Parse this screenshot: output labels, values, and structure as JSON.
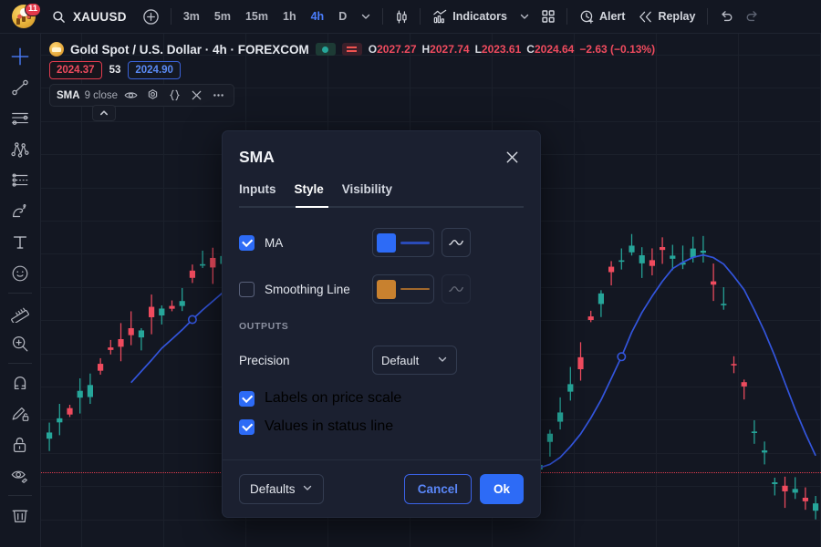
{
  "topbar": {
    "logo_badge": "11",
    "search_icon": "search-icon",
    "symbol": "XAUUSD",
    "plus_icon": "plus-circle-icon",
    "timeframes": [
      {
        "label": "3m",
        "active": false
      },
      {
        "label": "5m",
        "active": false
      },
      {
        "label": "15m",
        "active": false
      },
      {
        "label": "1h",
        "active": false
      },
      {
        "label": "4h",
        "active": true
      },
      {
        "label": "D",
        "active": false
      }
    ],
    "timeframe_caret": "chevron-down-icon",
    "candle_icon": "candlestick-icon",
    "indicators_label": "Indicators",
    "indicators_caret": "chevron-down-icon",
    "templates_icon": "grid-templates-icon",
    "alert_label": "Alert",
    "replay_label": "Replay",
    "undo_icon": "undo-icon",
    "redo_icon": "redo-icon"
  },
  "leftbar": {
    "tools": [
      {
        "name": "crosshair-tool",
        "active": true
      },
      {
        "name": "trend-line-tool",
        "active": false
      },
      {
        "name": "horizontal-lines-tool",
        "active": false
      },
      {
        "name": "pitchfork-tool",
        "active": false
      },
      {
        "name": "fib-retracement-tool",
        "active": false
      },
      {
        "name": "brush-tool",
        "active": false
      },
      {
        "name": "text-tool",
        "active": false
      },
      {
        "name": "emoji-tool",
        "active": false
      },
      {
        "name": "measure-tool",
        "active": false
      },
      {
        "name": "zoom-in-tool",
        "active": false
      },
      {
        "name": "magnet-tool",
        "active": false
      },
      {
        "name": "drawing-mode-tool",
        "active": false
      },
      {
        "name": "lock-drawings-tool",
        "active": false
      },
      {
        "name": "hide-drawings-tool",
        "active": false
      },
      {
        "name": "remove-drawings-tool",
        "active": false
      }
    ]
  },
  "chart": {
    "symbol_title": "Gold Spot / U.S. Dollar · 4h · FOREXCOM",
    "ohlc": {
      "o_label": "O",
      "o_value": "2027.27",
      "h_label": "H",
      "h_value": "2027.74",
      "l_label": "L",
      "l_value": "2023.61",
      "c_label": "C",
      "c_value": "2024.64",
      "change": "−2.63 (−0.13%)"
    },
    "price_tag_red": "2024.37",
    "price_tag_mid": "53",
    "price_tag_blue": "2024.90",
    "legend": {
      "indicator": "SMA",
      "args": "9 close",
      "icons": [
        "eye-icon",
        "settings-icon",
        "source-code-icon",
        "close-icon",
        "more-options-icon"
      ]
    },
    "collapse_icon": "chevron-up-icon"
  },
  "modal": {
    "title": "SMA",
    "close_icon": "close-icon",
    "tabs": [
      {
        "label": "Inputs",
        "active": false
      },
      {
        "label": "Style",
        "active": true
      },
      {
        "label": "Visibility",
        "active": false
      }
    ],
    "rows": [
      {
        "label": "MA",
        "checked": true,
        "color": "#2d6bf6",
        "line_color": "#2a4bb8",
        "line_style_icon": "line-style-icon",
        "dimmed": false
      },
      {
        "label": "Smoothing Line",
        "checked": false,
        "color": "#c8812f",
        "line_color": "#a1682c",
        "line_style_icon": "line-style-icon",
        "dimmed": true
      }
    ],
    "outputs_label": "OUTPUTS",
    "precision_label": "Precision",
    "precision_value": "Default",
    "precision_caret": "chevron-down-icon",
    "checkboxes": [
      {
        "label": "Labels on price scale",
        "checked": true
      },
      {
        "label": "Values in status line",
        "checked": true
      }
    ],
    "footer": {
      "defaults_label": "Defaults",
      "defaults_caret": "chevron-down-icon",
      "cancel_label": "Cancel",
      "ok_label": "Ok"
    }
  },
  "colors": {
    "accent_blue": "#2d6bf6",
    "bull_green": "#26a69a",
    "bear_red": "#ef4b5e",
    "sma_line": "#3355dd",
    "panel_bg": "#1b2030",
    "chart_bg": "#131722"
  },
  "chart_data": {
    "type": "candlestick",
    "sma_period": 9,
    "price_line": 2024.37
  }
}
